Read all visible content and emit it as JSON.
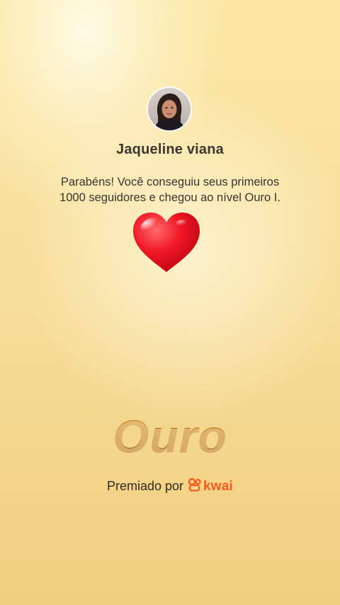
{
  "profile": {
    "username": "Jaqueline viana"
  },
  "message": {
    "line1": "Parabéns! Você conseguiu seus primeiros",
    "line2": "1000 seguidores e chegou ao nível Ouro I."
  },
  "level": {
    "title": "Ouro"
  },
  "footer": {
    "awarded_label": "Premiado por",
    "brand": "kwai",
    "brand_color": "#ff5a1f"
  },
  "icons": {
    "heart": "heart-emoji-icon",
    "kwai": "kwai-logo-icon"
  },
  "colors": {
    "background": "#f8e2a0",
    "heart": "#e8101e",
    "level_text": "#a8630f"
  }
}
